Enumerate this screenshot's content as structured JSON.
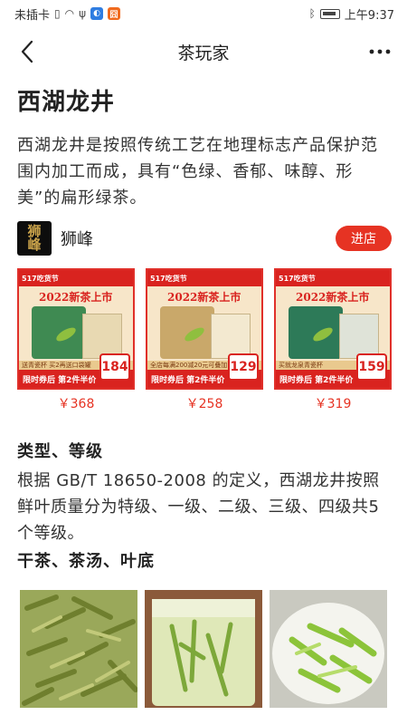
{
  "status_bar": {
    "carrier": "未插卡",
    "time": "上午9:37"
  },
  "nav": {
    "title": "茶玩家"
  },
  "article": {
    "title": "西湖龙井",
    "intro": "西湖龙井是按照传统工艺在地理标志产品保护范围内加工而成，具有“色绿、香郁、味醇、形美”的扁形绿茶。"
  },
  "brand": {
    "name": "狮峰",
    "logo_text": "狮峰",
    "store_button": "进店"
  },
  "products": [
    {
      "banner_left": "517吃货节",
      "banner_right": "2022新茶上市",
      "strip": "送青瓷杯 买2再送口袋罐",
      "bottom": "限时券后 第2件半价",
      "tag_price": "184",
      "price": "￥368"
    },
    {
      "banner_left": "517吃货节",
      "banner_right": "2022新茶上市",
      "strip": "全店每满200减20元可叠加",
      "bottom": "限时券后 第2件半价",
      "tag_price": "129",
      "price": "￥258"
    },
    {
      "banner_left": "517吃货节",
      "banner_right": "2022新茶上市",
      "strip": "买就龙泉青瓷杯",
      "bottom": "限时券后 第2件半价",
      "tag_price": "159",
      "price": "￥319"
    }
  ],
  "sections": {
    "grade_title": "类型、等级",
    "grade_body": "根据 GB/T 18650-2008 的定义，西湖龙井按照鲜叶质量分为特级、一级、二级、三级、四级共5个等级。",
    "tea_title": "干茶、茶汤、叶底"
  },
  "colors": {
    "accent": "#e63323",
    "promo_red": "#d9231f",
    "tea_green": "#7da83a"
  }
}
